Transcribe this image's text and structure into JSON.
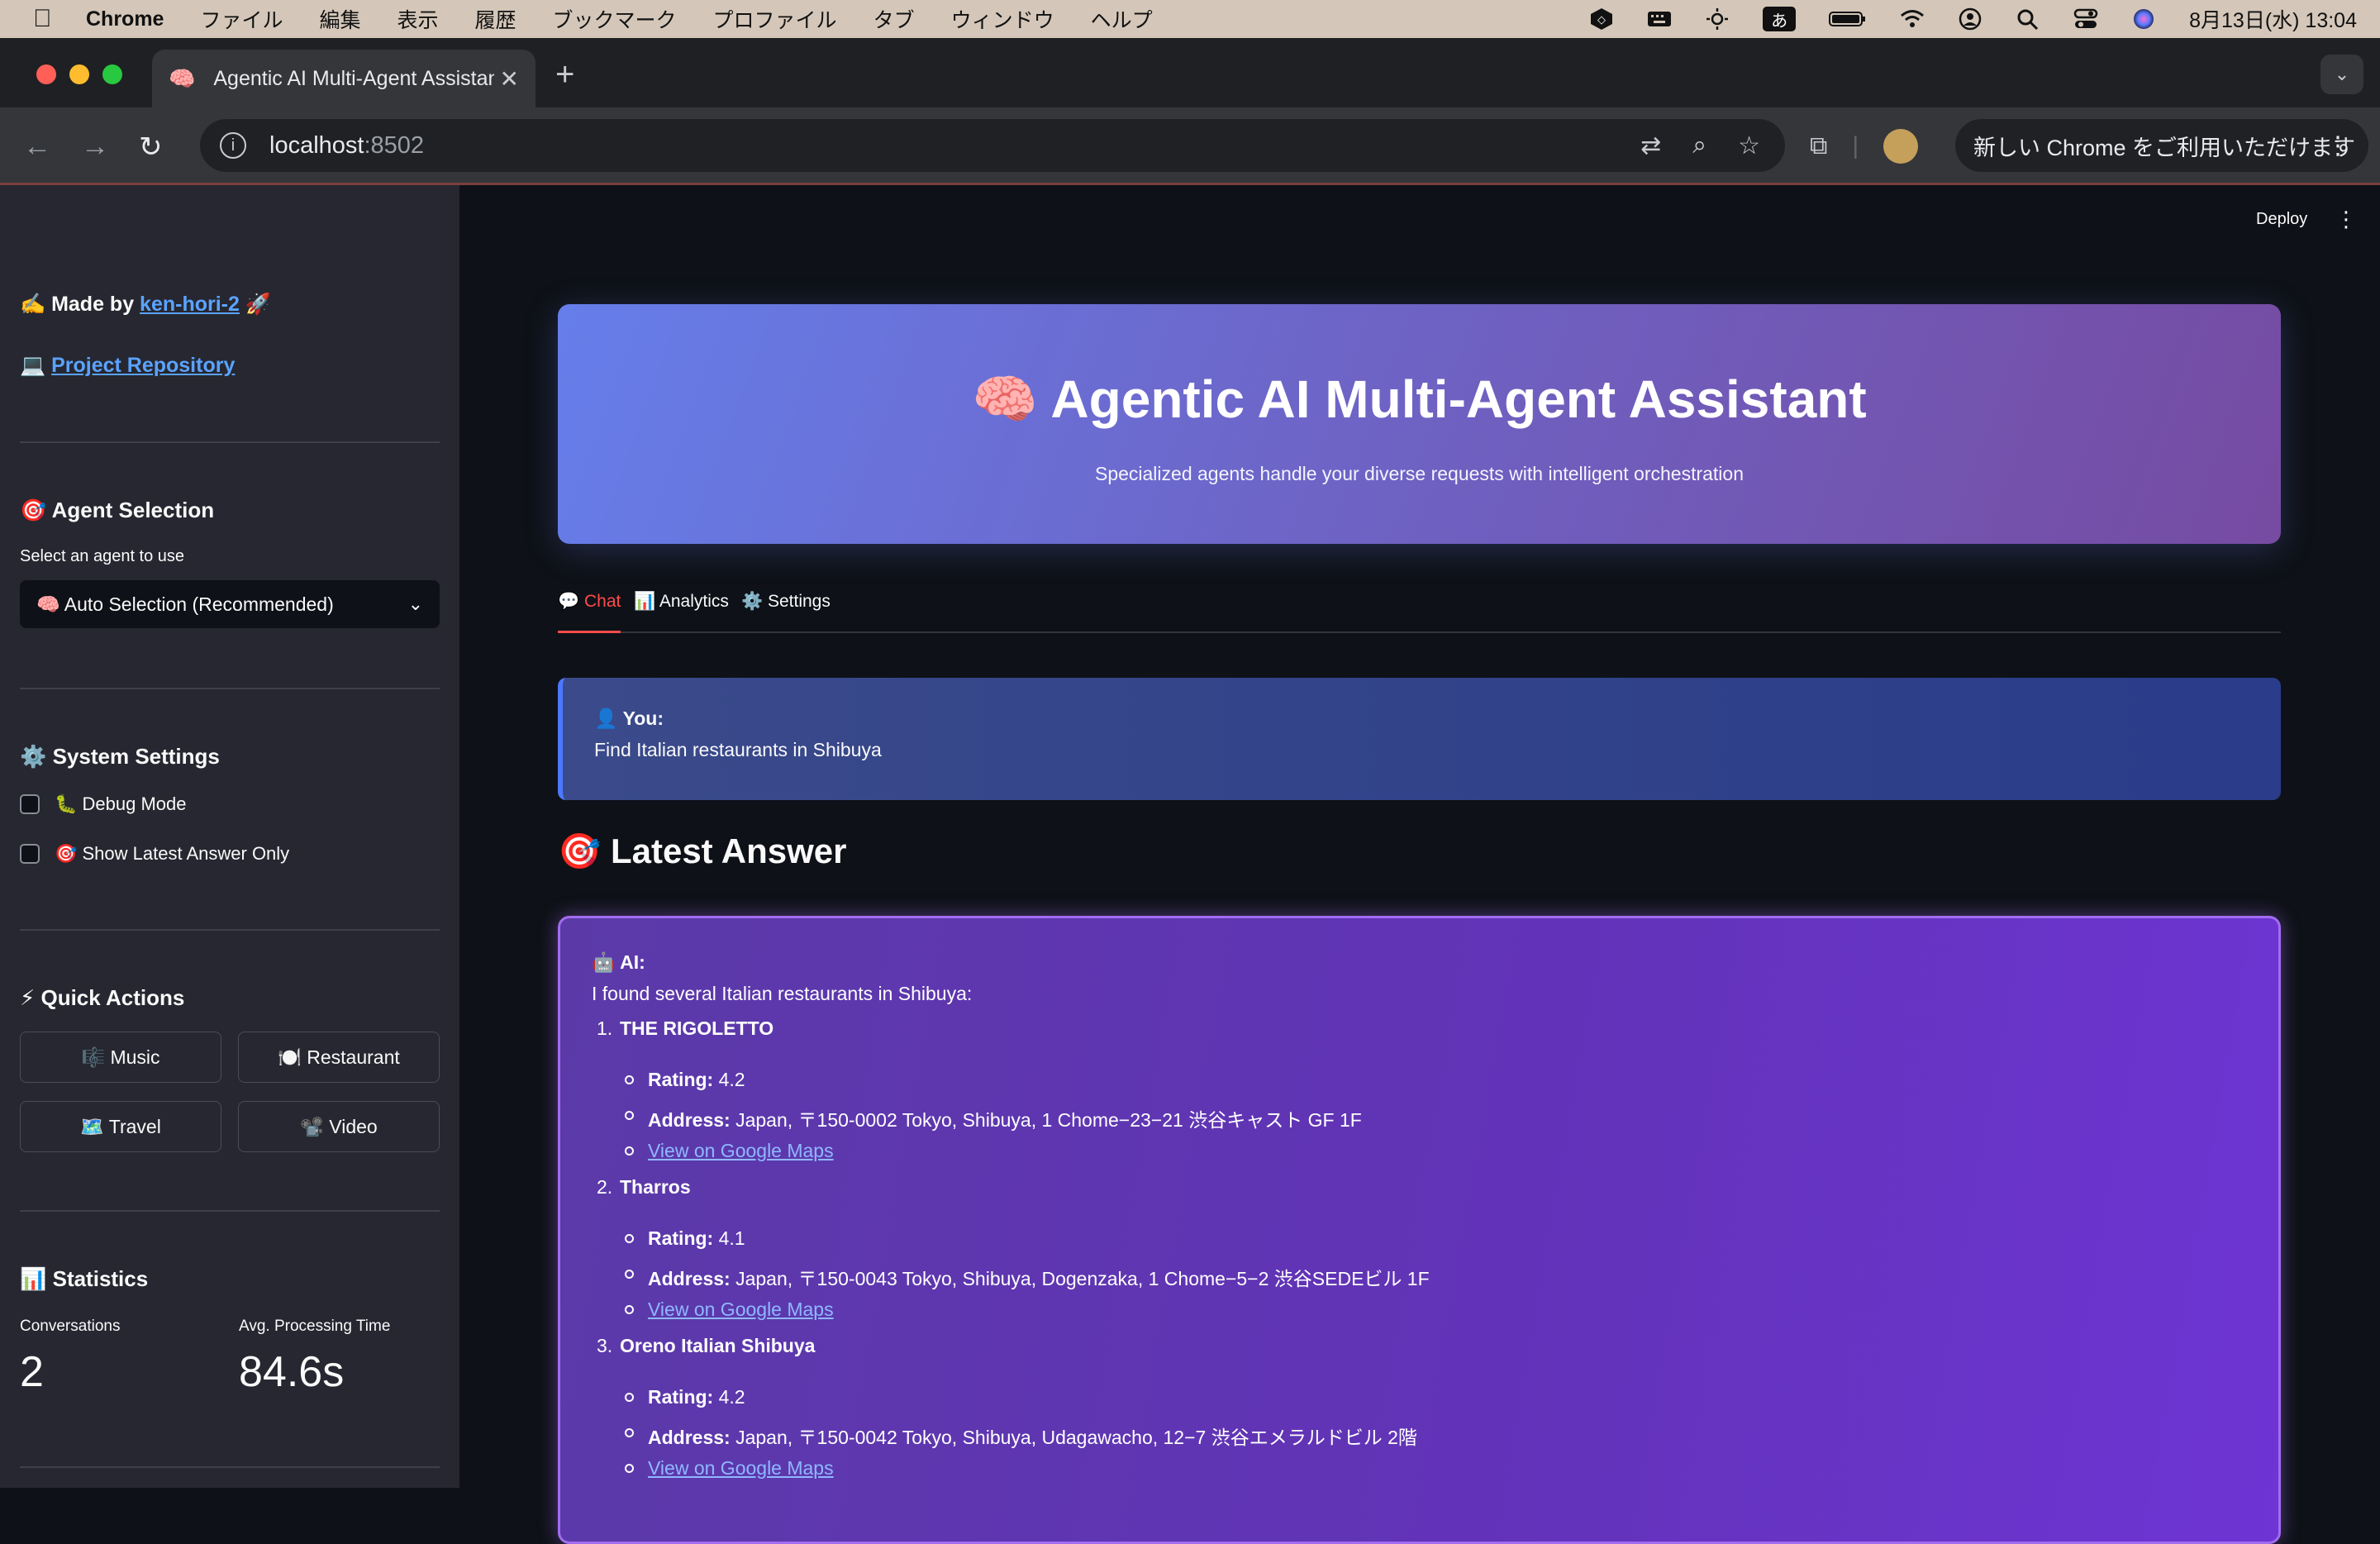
{
  "menubar": {
    "app": "Chrome",
    "items": [
      "ファイル",
      "編集",
      "表示",
      "履歴",
      "ブックマーク",
      "プロファイル",
      "タブ",
      "ウィンドウ",
      "ヘルプ"
    ],
    "ime": "あ",
    "clock": "8月13日(水)  13:04"
  },
  "browser": {
    "tab_title": "Agentic AI Multi-Agent Assistant",
    "tab_favicon": "🧠",
    "url_host": "localhost",
    "url_port": ":8502",
    "update_label": "新しい Chrome をご利用いただけます"
  },
  "sidebar": {
    "made_by_prefix": "✍️ Made by ",
    "made_by_link": "ken-hori-2",
    "made_by_suffix": " 🚀",
    "repo_prefix": "💻 ",
    "repo_link": "Project Repository",
    "agent_heading": "🎯 Agent Selection",
    "agent_label": "Select an agent to use",
    "agent_selected": "🧠 Auto Selection (Recommended)",
    "system_heading": "⚙️ System Settings",
    "debug_label": "🐛 Debug Mode",
    "latest_only_label": "🎯 Show Latest Answer Only",
    "quick_heading": "⚡ Quick Actions",
    "quick_actions": [
      "🎼 Music",
      "🍽️ Restaurant",
      "🗺️ Travel",
      "📽️ Video"
    ],
    "stats_heading": "📊 Statistics",
    "conversations_label": "Conversations",
    "conversations_value": "2",
    "avg_time_label": "Avg. Processing Time",
    "avg_time_value": "84.6s"
  },
  "header": {
    "deploy": "Deploy",
    "title": "🧠 Agentic AI Multi-Agent Assistant",
    "subtitle": "Specialized agents handle your diverse requests with intelligent orchestration"
  },
  "tabs": [
    "💬 Chat",
    "📊 Analytics",
    "⚙️ Settings"
  ],
  "user_message": {
    "who": "👤 You:",
    "text": "Find Italian restaurants in Shibuya"
  },
  "latest_heading": "🎯 Latest Answer",
  "ai_answer": {
    "who": "🤖 AI:",
    "intro": "I found several Italian restaurants in Shibuya:",
    "rating_label": "Rating:",
    "address_label": "Address:",
    "maps_link": "View on Google Maps",
    "restaurants": [
      {
        "num": "1.",
        "name": "THE RIGOLETTO",
        "rating": "4.2",
        "address": "Japan, 〒150-0002 Tokyo, Shibuya, 1 Chome−23−21 渋谷キャスト GF 1F"
      },
      {
        "num": "2.",
        "name": "Tharros",
        "rating": "4.1",
        "address": "Japan, 〒150-0043 Tokyo, Shibuya, Dogenzaka, 1 Chome−5−2 渋谷SEDEビル 1F"
      },
      {
        "num": "3.",
        "name": "Oreno Italian Shibuya",
        "rating": "4.2",
        "address": "Japan, 〒150-0042 Tokyo, Shibuya, Udagawacho, 12−7 渋谷エメラルドビル 2階"
      }
    ]
  }
}
